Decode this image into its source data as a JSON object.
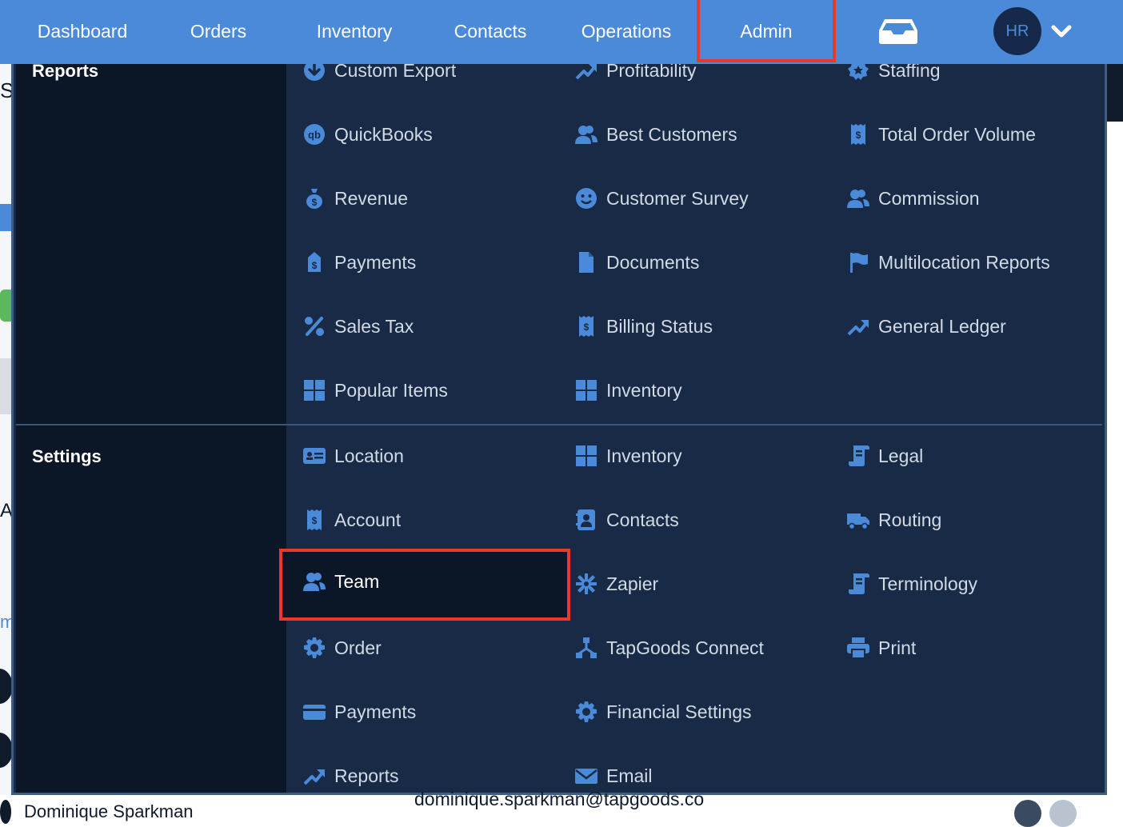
{
  "nav": {
    "items": [
      "Dashboard",
      "Orders",
      "Inventory",
      "Contacts",
      "Operations"
    ],
    "active": "Admin",
    "avatar_initials": "HR",
    "icons": [
      "inbox-icon",
      "chevron-down-icon"
    ]
  },
  "background": {
    "frag_se": "Se",
    "frag_all": "All",
    "frag_m": "m",
    "contact_name": "Dominique Sparkman",
    "contact_email": "dominique.sparkman@tapgoods.co"
  },
  "reports": {
    "title": "Reports",
    "col1": [
      "Custom Export",
      "QuickBooks",
      "Revenue",
      "Payments",
      "Sales Tax",
      "Popular Items"
    ],
    "col2": [
      "Profitability",
      "Best Customers",
      "Customer Survey",
      "Documents",
      "Billing Status",
      "Inventory"
    ],
    "col3": [
      "Staffing",
      "Total Order Volume",
      "Commission",
      "Multilocation Reports",
      "General Ledger"
    ]
  },
  "settings": {
    "title": "Settings",
    "col1": [
      "Location",
      "Account",
      "Team",
      "Order",
      "Payments",
      "Reports"
    ],
    "col2": [
      "Inventory",
      "Contacts",
      "Zapier",
      "TapGoods Connect",
      "Financial Settings",
      "Email"
    ],
    "col3": [
      "Legal",
      "Routing",
      "Terminology",
      "Print"
    ]
  },
  "colors": {
    "nav_bg": "#4a8ad9",
    "menu_bg": "#182a45",
    "side_bg": "#0b1727",
    "icon": "#4a8ad9",
    "highlight": "#e8392a"
  }
}
